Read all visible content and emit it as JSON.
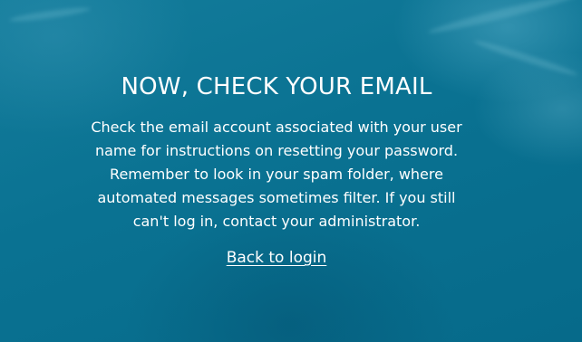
{
  "page": {
    "background_color": "#0a7393",
    "text_color": "#ffffff"
  },
  "main": {
    "title": "NOW, CHECK YOUR EMAIL",
    "message_lines": [
      "Check the email account associated with your user",
      "name for instructions on resetting your password.",
      "Remember to look in your spam folder, where",
      "automated messages sometimes filter. If you still",
      "can't log in, contact your administrator."
    ],
    "back_link_label": "Back to login"
  }
}
